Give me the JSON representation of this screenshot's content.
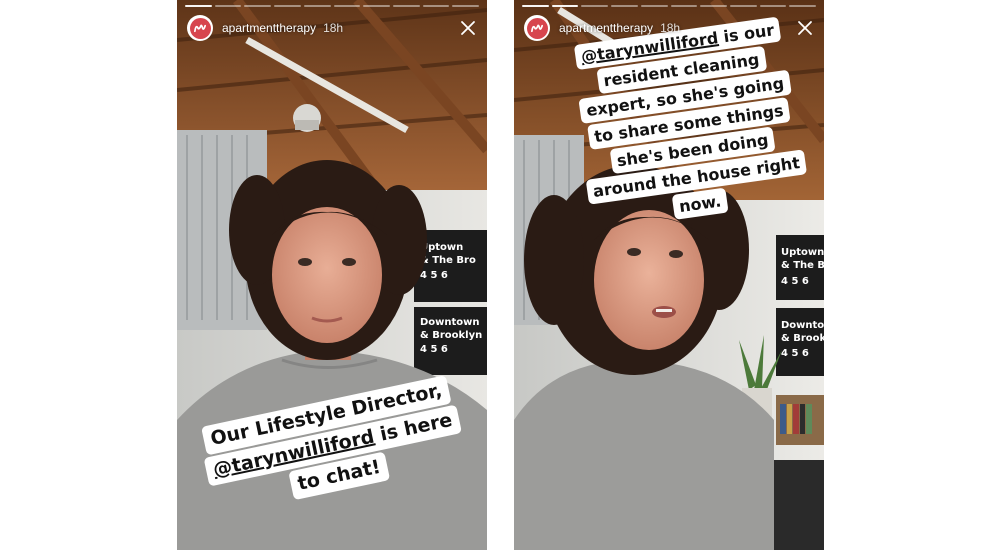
{
  "stories": [
    {
      "account": {
        "username": "apartmenttherapy",
        "time_ago": "18h"
      },
      "progress": {
        "segments": 10,
        "active": 1
      },
      "sign_lines": [
        "Uptown",
        "& The Bro",
        "4 5 6",
        "Downtown",
        "& Brooklyn",
        "4 5 6"
      ],
      "caption": {
        "line1": "Our Lifestyle Director,",
        "line2_mention": "@tarynwilliford",
        "line2_rest": " is here",
        "line3": "to chat!"
      }
    },
    {
      "account": {
        "username": "apartmenttherapy",
        "time_ago": "18h"
      },
      "progress": {
        "segments": 10,
        "active": 2
      },
      "sign_lines": [
        "Uptown",
        "& The Br",
        "4 5 6",
        "Downto",
        "& Brook",
        "4 5 6"
      ],
      "caption": {
        "line1_mention": "@tarynwilliford",
        "line1_rest": " is our",
        "line2": "resident cleaning",
        "line3": "expert, so she's going",
        "line4": "to share some things",
        "line5": "she's been doing",
        "line6": "around the house right",
        "line7": "now."
      }
    }
  ],
  "colors": {
    "avatar_brand": "#d7454e",
    "caption_background": "#ffffff",
    "caption_text": "#111111"
  },
  "icons": {
    "close": "close-icon",
    "avatar": "apartmenttherapy-logo"
  }
}
